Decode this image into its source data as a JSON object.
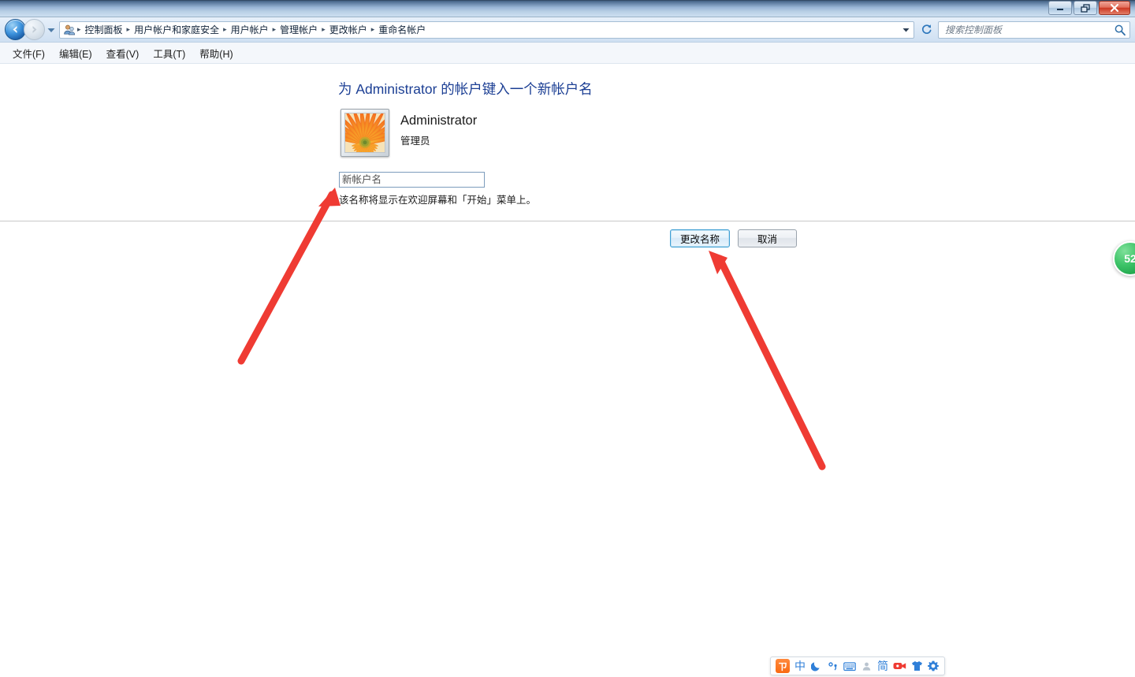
{
  "window": {
    "controls": {
      "minimize_label": "最小化",
      "maximize_label": "最大化",
      "close_label": "关闭"
    }
  },
  "nav": {
    "back_label": "后退",
    "forward_label": "前进",
    "recent_pages_label": "最近浏览的页面",
    "refresh_label": "刷新",
    "breadcrumbs": [
      "控制面板",
      "用户帐户和家庭安全",
      "用户帐户",
      "管理帐户",
      "更改帐户",
      "重命名帐户"
    ],
    "separator": "▸",
    "address_dropdown_label": "▾"
  },
  "search": {
    "placeholder": "搜索控制面板",
    "value": ""
  },
  "menu": {
    "items": [
      "文件(F)",
      "编辑(E)",
      "查看(V)",
      "工具(T)",
      "帮助(H)"
    ]
  },
  "main": {
    "heading": "为 Administrator 的帐户键入一个新帐户名",
    "account": {
      "name": "Administrator",
      "role": "管理员",
      "avatar_icon": "flower-avatar-icon"
    },
    "new_name_input": {
      "placeholder": "新帐户名",
      "value": ""
    },
    "hint": "该名称将显示在欢迎屏幕和「开始」菜单上。",
    "buttons": {
      "primary": "更改名称",
      "secondary": "取消"
    }
  },
  "badge": {
    "value": "52"
  },
  "ime": {
    "items": [
      {
        "name": "sogou-logo-icon",
        "glyph": "ㄗ"
      },
      {
        "name": "chinese-mode-icon",
        "glyph": "中"
      },
      {
        "name": "moon-icon",
        "glyph": "☾"
      },
      {
        "name": "punctuation-icon",
        "glyph": "°,"
      },
      {
        "name": "soft-keyboard-icon",
        "glyph": "⌨"
      },
      {
        "name": "user-icon",
        "glyph": "▲"
      },
      {
        "name": "simplified-chinese-icon",
        "glyph": "简"
      },
      {
        "name": "video-icon",
        "glyph": "▶"
      },
      {
        "name": "skin-icon",
        "glyph": "T"
      },
      {
        "name": "settings-gear-icon",
        "glyph": "⚙"
      }
    ]
  },
  "annotations": {
    "arrow_input_label": "指向新帐户名输入框的箭头",
    "arrow_button_label": "指向更改名称按钮的箭头",
    "color": "#ef3b33"
  },
  "colors": {
    "heading": "#1c3f94",
    "accent": "#3e9fd4",
    "badge_green": "#3cc367",
    "arrow_red": "#ef3b33"
  }
}
